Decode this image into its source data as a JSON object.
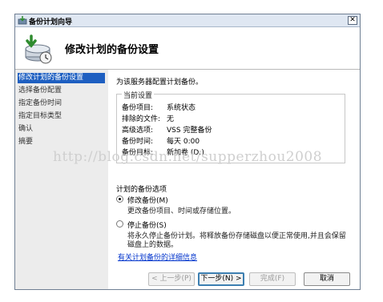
{
  "window": {
    "title": "备份计划向导",
    "close_glyph": "✕"
  },
  "header": {
    "title": "修改计划的备份设置",
    "icon": "backup-wizard-icon"
  },
  "nav": {
    "items": [
      {
        "label": "修改计划的备份设置",
        "active": true
      },
      {
        "label": "选择备份配置",
        "active": false
      },
      {
        "label": "指定备份时间",
        "active": false
      },
      {
        "label": "指定目标类型",
        "active": false
      },
      {
        "label": "确认",
        "active": false
      },
      {
        "label": "摘要",
        "active": false
      }
    ]
  },
  "content": {
    "intro": "为该服务器配置计划备份。",
    "current_settings": {
      "legend": "当前设置",
      "rows": [
        {
          "key": "备份项目:",
          "value": "系统状态"
        },
        {
          "key": "排除的文件:",
          "value": "无"
        },
        {
          "key": "高级选项:",
          "value": "VSS 完整备份"
        },
        {
          "key": "备份时间:",
          "value": "每天 0:00"
        },
        {
          "key": "备份目标:",
          "value": "新加卷 (D:)"
        }
      ]
    },
    "options_label": "计划的备份选项",
    "options": [
      {
        "label": "修改备份(M)",
        "description": "更改备份项目、时间或存储位置。",
        "selected": true
      },
      {
        "label": "停止备份(S)",
        "description_line1": "将永久停止备份计划。将释放备份存储磁盘以便正常使用,并且会保留",
        "description_line2": "磁盘上的数据。",
        "selected": false
      }
    ],
    "link": "有关计划备份的详细信息"
  },
  "buttons": {
    "back": "< 上一步(P)",
    "next": "下一步(N) >",
    "finish": "完成(F)",
    "cancel": "取消"
  },
  "watermark": "http://blog.csdn.net/supperzhou2008"
}
